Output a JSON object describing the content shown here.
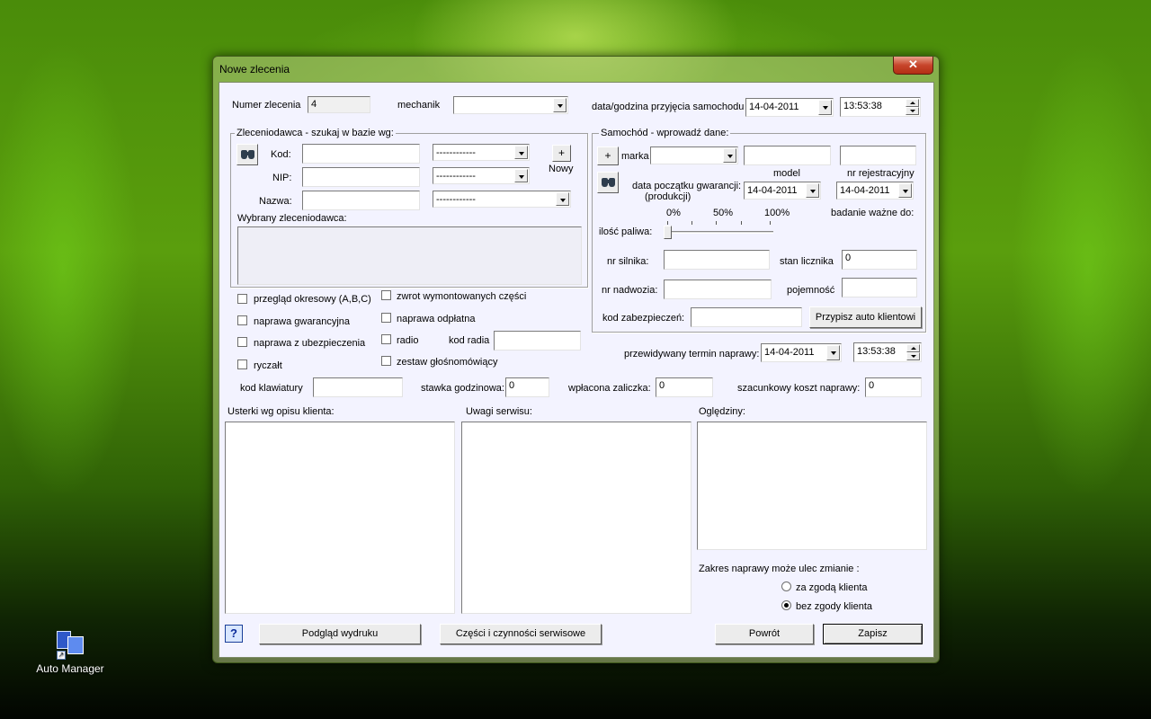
{
  "desktop": {
    "icon_label": "Auto Manager",
    "icon_name": "auto-manager-app-icon"
  },
  "window": {
    "title": "Nowe zlecenia",
    "close_glyph": "✕"
  },
  "header": {
    "order_number_label": "Numer zlecenia",
    "order_number_value": "4",
    "mechanic_label": "mechanik",
    "mechanic_value": "",
    "intake_label": "data/godzina przyjęcia samochodu",
    "intake_date": "14-04-2011",
    "intake_time": "13:53:38"
  },
  "client": {
    "group_title": "Zleceniodawca - szukaj w bazie wg:",
    "kod_label": "Kod:",
    "nip_label": "NIP:",
    "nazwa_label": "Nazwa:",
    "kod_value": "",
    "nip_value": "",
    "nazwa_value": "",
    "kod_combo": "------------",
    "nip_combo": "------------",
    "nazwa_combo": "------------",
    "new_button": "+",
    "new_label": "Nowy",
    "selected_label": "Wybrany zleceniodawca:"
  },
  "car": {
    "group_title": "Samochód - wprowadź dane:",
    "add_button": "+",
    "marka_label": "marka",
    "marka_value": "",
    "model_label": "model",
    "model_value": "",
    "reg_label": "nr rejestracyjny",
    "reg_value": "",
    "warranty_label_1": "data początku gwarancji:",
    "warranty_label_2": "(produkcji)",
    "warranty_date": "14-04-2011",
    "inspection_date": "14-04-2011",
    "inspection_label": "badanie ważne do:",
    "fuel_label": "ilość paliwa:",
    "fuel_ticks": [
      "0%",
      "50%",
      "100%"
    ],
    "fuel_level": 0,
    "engine_label": "nr silnika:",
    "engine_value": "",
    "odometer_label": "stan licznika",
    "odometer_value": "0",
    "vin_label": "nr nadwozia:",
    "vin_value": "",
    "capacity_label": "pojemność",
    "capacity_value": "",
    "security_label": "kod zabezpieczeń:",
    "security_value": "",
    "assign_button": "Przypisz auto klientowi"
  },
  "options": {
    "przeglad": "przegląd okresowy (A,B,C)",
    "gwarancyjna": "naprawa gwarancyjna",
    "ubezpieczenie": "naprawa z ubezpieczenia",
    "ryczalt": "ryczałt",
    "zwrot": "zwrot wymontowanych części",
    "odplatna": "naprawa odpłatna",
    "radio": "radio",
    "kod_radia_label": "kod radia",
    "kod_radia_value": "",
    "glosnomowiacy": "zestaw głośnomówiący"
  },
  "repair": {
    "deadline_label": "przewidywany termin naprawy:",
    "deadline_date": "14-04-2011",
    "deadline_time": "13:53:38"
  },
  "costs": {
    "keyboard_label": "kod klawiatury",
    "keyboard_value": "",
    "rate_label": "stawka godzinowa:",
    "rate_value": "0",
    "deposit_label": "wpłacona zaliczka:",
    "deposit_value": "0",
    "estimate_label": "szacunkowy koszt naprawy:",
    "estimate_value": "0"
  },
  "notes": {
    "faults_label": "Usterki wg opisu klienta:",
    "service_label": "Uwagi serwisu:",
    "inspection_label": "Oględziny:"
  },
  "scope": {
    "label": "Zakres naprawy może ulec zmianie :",
    "with_consent": "za zgodą klienta",
    "without_consent": "bez zgody klienta"
  },
  "footer": {
    "help": "?",
    "preview": "Podgląd wydruku",
    "parts": "Części i czynności serwisowe",
    "back": "Powrót",
    "save": "Zapisz"
  }
}
